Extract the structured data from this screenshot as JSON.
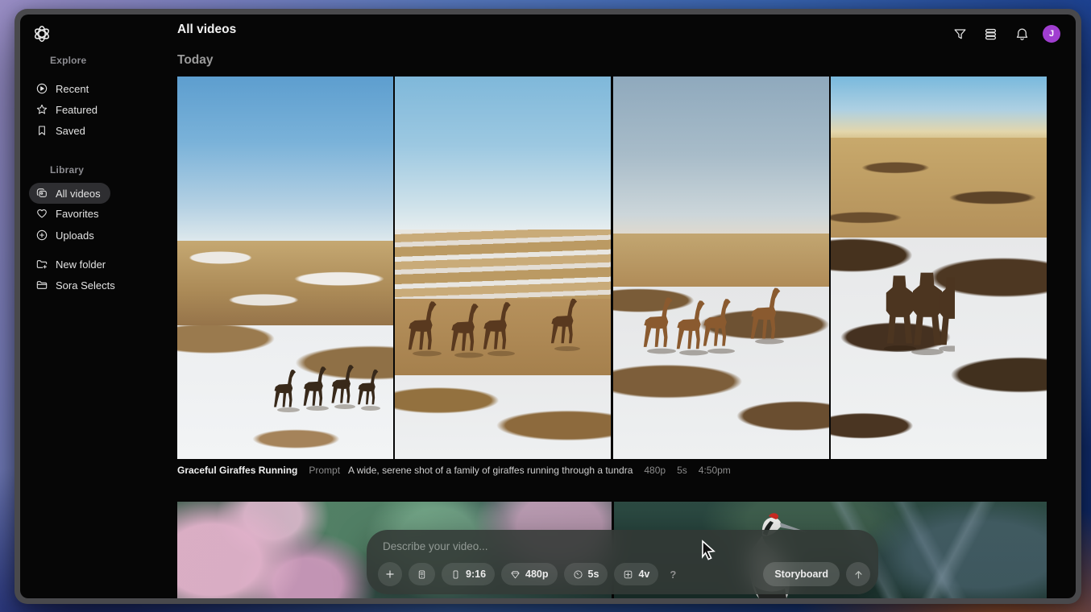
{
  "header": {
    "title": "All videos",
    "icons": [
      "filter-icon",
      "view-options-icon",
      "notifications-icon"
    ],
    "avatar_initial": "J",
    "avatar_color": "#A03ED0"
  },
  "sidebar": {
    "sections": [
      {
        "label": "Explore",
        "items": [
          {
            "label": "Recent",
            "icon": "play-circle-icon"
          },
          {
            "label": "Featured",
            "icon": "star-icon"
          },
          {
            "label": "Saved",
            "icon": "bookmark-icon"
          }
        ]
      },
      {
        "label": "Library",
        "items": [
          {
            "label": "All videos",
            "icon": "video-stack-icon",
            "selected": true
          },
          {
            "label": "Favorites",
            "icon": "heart-icon"
          },
          {
            "label": "Uploads",
            "icon": "upload-plus-icon"
          }
        ]
      },
      {
        "label": "",
        "items": [
          {
            "label": "New folder",
            "icon": "folder-plus-icon"
          },
          {
            "label": "Sora Selects",
            "icon": "folder-icon"
          }
        ]
      }
    ]
  },
  "main": {
    "date_label": "Today",
    "video_group": {
      "title": "Graceful Giraffes Running",
      "prompt_label": "Prompt",
      "prompt_text": "A wide, serene shot of a family of giraffes running through a tundra",
      "resolution": "480p",
      "duration": "5s",
      "time": "4:50pm",
      "variant_count": 4,
      "variant_descriptions": [
        "four giraffes walking on snow, wide blue sky",
        "four giraffes striding left across tan grassland with snow bands",
        "four giraffes on mottled snow-patched tundra under hazy sky",
        "three giraffes seen from behind on rocky snow field, golden horizon"
      ]
    },
    "next_row_descriptions": [
      "blurred pink blossoms over green foliage",
      "red-crowned crane beside dark green water"
    ]
  },
  "composer": {
    "placeholder": "Describe your video...",
    "aspect_ratio": "9:16",
    "resolution": "480p",
    "duration": "5s",
    "variations": "4v",
    "help": "?",
    "storyboard": "Storyboard",
    "buttons": [
      "add",
      "preset",
      "aspect-ratio",
      "resolution",
      "duration",
      "variations",
      "help",
      "storyboard",
      "submit"
    ]
  },
  "colors": {
    "selected_pill": "#2e2e31",
    "avatar": "#A03ED0",
    "composer_bg": "rgba(50,56,52,0.88)"
  }
}
